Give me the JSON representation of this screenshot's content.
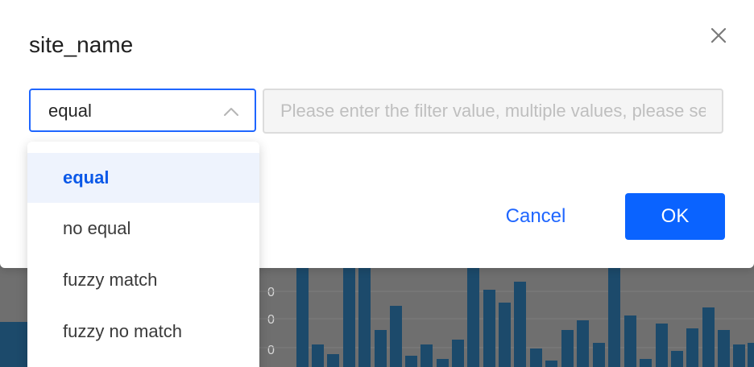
{
  "modal": {
    "title": "site_name",
    "close_icon": "close-icon",
    "operator_select": {
      "value": "equal",
      "arrow_icon": "chevron-up-icon",
      "options": [
        "equal",
        "no equal",
        "fuzzy match",
        "fuzzy no match"
      ],
      "selected_index": 0
    },
    "filter_input": {
      "value": "",
      "placeholder": "Please enter the filter value, multiple values, please separate them"
    },
    "cancel_label": "Cancel",
    "ok_label": "OK"
  },
  "background": {
    "bar_color": "#1c4a6b",
    "axis_tick_fragments": [
      "0",
      "0",
      "0"
    ]
  },
  "colors": {
    "primary": "#0a63ff",
    "selected_bg": "#eef3fd",
    "selected_text": "#0a58e8"
  }
}
